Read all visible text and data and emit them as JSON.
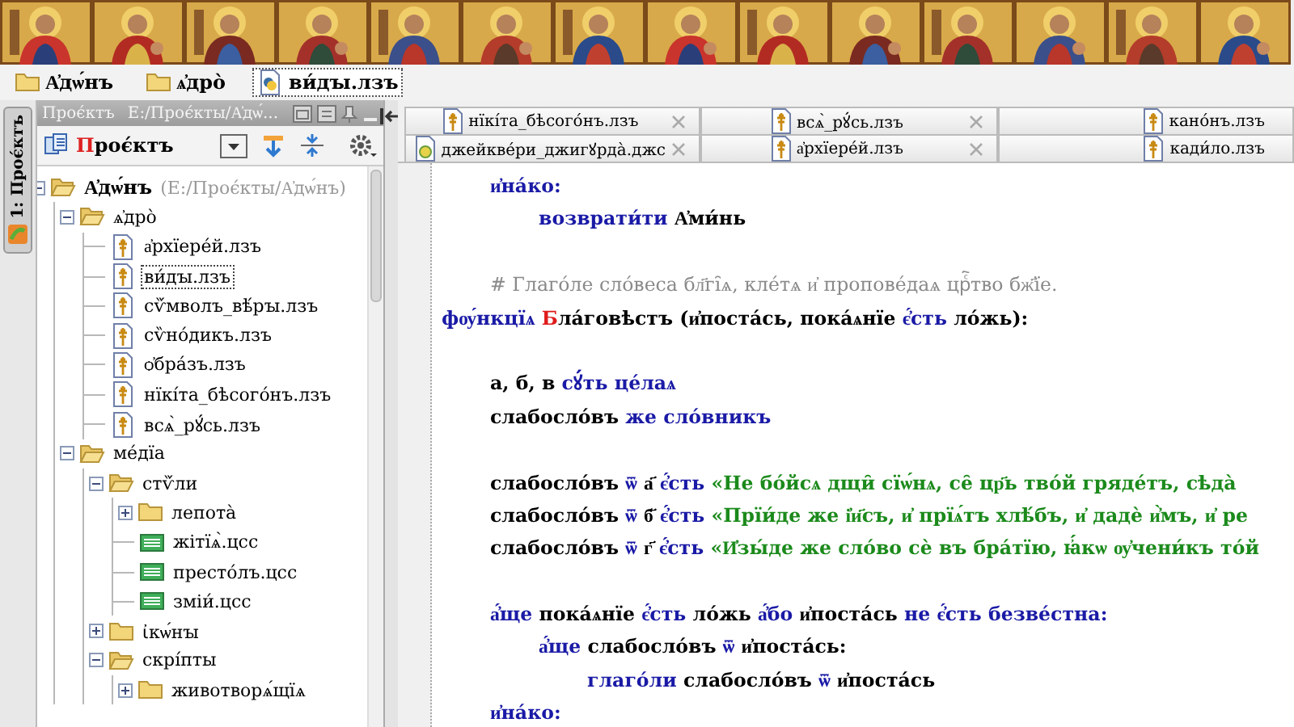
{
  "gallery": [
    {
      "kind": "picture"
    },
    {
      "kind": "picture"
    },
    {
      "kind": "picture"
    },
    {
      "kind": "picture"
    },
    {
      "kind": "picture"
    },
    {
      "kind": "picture"
    },
    {
      "kind": "picture"
    },
    {
      "kind": "picture"
    },
    {
      "kind": "picture"
    },
    {
      "kind": "picture"
    },
    {
      "kind": "picture"
    },
    {
      "kind": "picture"
    },
    {
      "kind": "picture"
    },
    {
      "kind": "picture"
    }
  ],
  "breadcrumbs": [
    {
      "label": "А҆дѡ́нъ",
      "kind": "folder",
      "selected": false
    },
    {
      "label": "ѧ҆дро̀",
      "kind": "folder",
      "selected": false
    },
    {
      "label": "ви́дꙑ.лзъ",
      "kind": "script",
      "selected": true
    }
  ],
  "tool_window_tab": {
    "label": "1: Проє́ктъ",
    "selected": true
  },
  "project_panel": {
    "title": "Проє́ктъ",
    "path": "Е:/Проє́кты/А҆дѡ́...",
    "view": "Проє́ктъ",
    "tree": [
      {
        "label": "А҆дѡ́нъ",
        "path": "(Е:/Проє́кты/А҆дѡ́нъ)",
        "kind": "folder",
        "expanded": true,
        "selected": false,
        "children": [
          {
            "label": "ѧ҆дро̀",
            "kind": "folder",
            "expanded": true,
            "selected": false,
            "children": [
              {
                "label": "а҆рхїере́й.лзъ",
                "kind": "file",
                "selected": false
              },
              {
                "label": "ви́дꙑ.лзъ",
                "kind": "file",
                "selected": true
              },
              {
                "label": "сѷ́мволъ_вѣ́рꙑ.лзъ",
                "kind": "file",
                "selected": false
              },
              {
                "label": "сѷно́дикъ.лзъ",
                "kind": "file",
                "selected": false
              },
              {
                "label": "ѻ҆бра́зъ.лзъ",
                "kind": "file",
                "selected": false
              },
              {
                "label": "нїкі́та_бѣсого́нъ.лзъ",
                "kind": "file",
                "selected": false
              },
              {
                "label": "всѧ̀_рꙋ́сь.лзъ",
                "kind": "file",
                "selected": false
              }
            ]
          },
          {
            "label": "ме́дїа",
            "kind": "folder",
            "expanded": true,
            "selected": false,
            "children": [
              {
                "label": "стѷ́ли",
                "kind": "folder",
                "expanded": true,
                "selected": false,
                "children": [
                  {
                    "label": "лепота̀",
                    "kind": "folder",
                    "expanded": false,
                    "selected": false
                  },
                  {
                    "label": "жітїѧ̀.цсс",
                    "kind": "css",
                    "selected": false
                  },
                  {
                    "label": "престо́лъ.цсс",
                    "kind": "css",
                    "selected": false
                  },
                  {
                    "label": "зміи́.цсс",
                    "kind": "css",
                    "selected": false
                  }
                ]
              },
              {
                "label": "ꙇ҆кѡ́нꙑ",
                "kind": "folder",
                "expanded": false,
                "selected": false
              },
              {
                "label": "скрі́пты",
                "kind": "folder",
                "expanded": true,
                "selected": false,
                "children": [
                  {
                    "label": "животворѧ́щїѧ",
                    "kind": "folder",
                    "expanded": false,
                    "selected": false
                  }
                ]
              }
            ]
          }
        ]
      }
    ]
  },
  "editor_tabs": [
    [
      {
        "label": "нїкі́та_бѣсого́нъ.лзъ",
        "kind": "lz",
        "closable": true
      },
      {
        "label": "всѧ̀_рꙋ́сь.лзъ",
        "kind": "lz",
        "closable": true
      },
      {
        "label": "кано́нъ.лзъ",
        "kind": "lz",
        "closable": false
      }
    ],
    [
      {
        "label": "джейкве́ри_джигꙋрда̀.джс",
        "kind": "js",
        "closable": true
      },
      {
        "label": "а҆рхїере́й.лзъ",
        "kind": "lz",
        "closable": true
      },
      {
        "label": "кади́ло.лзъ",
        "kind": "lz",
        "closable": false
      }
    ]
  ],
  "code": [
    {
      "kind": "block",
      "children": [
        {
          "kind": "line",
          "tokens": [
            {
              "kind": "keyword",
              "t": "и҆на́ко:"
            }
          ],
          "children": [
            {
              "kind": "line",
              "tokens": [
                {
                  "kind": "keyword",
                  "t": "возврати́ти"
                },
                {
                  "kind": "plain",
                  "t": " А҆ми́нь"
                }
              ]
            }
          ]
        },
        {
          "kind": "blank"
        },
        {
          "kind": "line",
          "tokens": [
            {
              "kind": "comment",
              "t": "# Глаго́ле сло́веса бл҃гі̑ѧ, кле́тѧ и҆ пропове́даѧ црⷭ҇тво бж҃їе."
            }
          ]
        }
      ]
    },
    {
      "kind": "line",
      "tokens": [
        {
          "kind": "keyword",
          "t": "фѹ́нкцїѧ "
        },
        {
          "kind": "name",
          "t": "Бла́говѣстъ"
        },
        {
          "kind": "plain",
          "t": " (и҆поста́сь, пока́ѧнїе "
        },
        {
          "kind": "keyword",
          "t": "є҆́сть"
        },
        {
          "kind": "plain",
          "t": " ло́жь):"
        }
      ],
      "children": [
        {
          "kind": "blank"
        },
        {
          "kind": "line",
          "tokens": [
            {
              "kind": "plain",
              "t": "а, б, в "
            },
            {
              "kind": "keyword",
              "t": "сꙋ́ть це́лаѧ"
            }
          ]
        },
        {
          "kind": "line",
          "tokens": [
            {
              "kind": "plain",
              "t": "слабосло́въ "
            },
            {
              "kind": "keyword",
              "t": "же сло́вникъ"
            }
          ]
        },
        {
          "kind": "blank"
        },
        {
          "kind": "line",
          "tokens": [
            {
              "kind": "plain",
              "t": "слабосло́въ "
            },
            {
              "kind": "keyword",
              "t": "ѿ"
            },
            {
              "kind": "plain",
              "t": " а҃ "
            },
            {
              "kind": "keyword",
              "t": "є҆́сть"
            },
            {
              "kind": "string",
              "t": " «Не бо́йсѧ дщи̑ сїѡ́нѧ, се̑ цр҃ь тво́й гряде́тъ, сѣда̀"
            }
          ]
        },
        {
          "kind": "line",
          "tokens": [
            {
              "kind": "plain",
              "t": "слабосло́въ "
            },
            {
              "kind": "keyword",
              "t": "ѿ"
            },
            {
              "kind": "plain",
              "t": " б҃ "
            },
            {
              "kind": "keyword",
              "t": "є҆́сть"
            },
            {
              "kind": "string",
              "t": " «Прїи́де же і҆и҃съ, и҆ прїѧ́тъ хлѣ́бъ, и҆ дадѐ и҆̀мъ, и҆ ре"
            }
          ]
        },
        {
          "kind": "line",
          "tokens": [
            {
              "kind": "plain",
              "t": "слабосло́въ "
            },
            {
              "kind": "keyword",
              "t": "ѿ"
            },
            {
              "kind": "plain",
              "t": " г҃ "
            },
            {
              "kind": "keyword",
              "t": "є҆́сть"
            },
            {
              "kind": "string",
              "t": " «И҆зы́де же сло́во сѐ въ бра́тїю, ꙗ҆́кѡ ѹ҆чени́къ то́й"
            }
          ]
        },
        {
          "kind": "blank"
        },
        {
          "kind": "line",
          "tokens": [
            {
              "kind": "keyword",
              "t": "а҆́ще"
            },
            {
              "kind": "plain",
              "t": " пока́ѧнїе "
            },
            {
              "kind": "keyword",
              "t": "є҆́сть"
            },
            {
              "kind": "plain",
              "t": " ло́жь "
            },
            {
              "kind": "keyword",
              "t": "а҆́бо"
            },
            {
              "kind": "plain",
              "t": " и҆поста́сь "
            },
            {
              "kind": "keyword",
              "t": "не є҆́сть безве́стна:"
            }
          ],
          "children": [
            {
              "kind": "line",
              "tokens": [
                {
                  "kind": "keyword",
                  "t": "а҆́ще"
                },
                {
                  "kind": "plain",
                  "t": " слабосло́въ "
                },
                {
                  "kind": "keyword",
                  "t": "ѿ"
                },
                {
                  "kind": "plain",
                  "t": " и҆поста́сь:"
                }
              ],
              "children": [
                {
                  "kind": "line",
                  "tokens": [
                    {
                      "kind": "keyword",
                      "t": "глаго́ли"
                    },
                    {
                      "kind": "plain",
                      "t": " слабосло́въ "
                    },
                    {
                      "kind": "keyword",
                      "t": "ѿ"
                    },
                    {
                      "kind": "plain",
                      "t": " и҆поста́сь"
                    }
                  ]
                }
              ]
            }
          ]
        },
        {
          "kind": "line",
          "tokens": [
            {
              "kind": "keyword",
              "t": "и҆на́ко:"
            }
          ]
        }
      ]
    }
  ]
}
